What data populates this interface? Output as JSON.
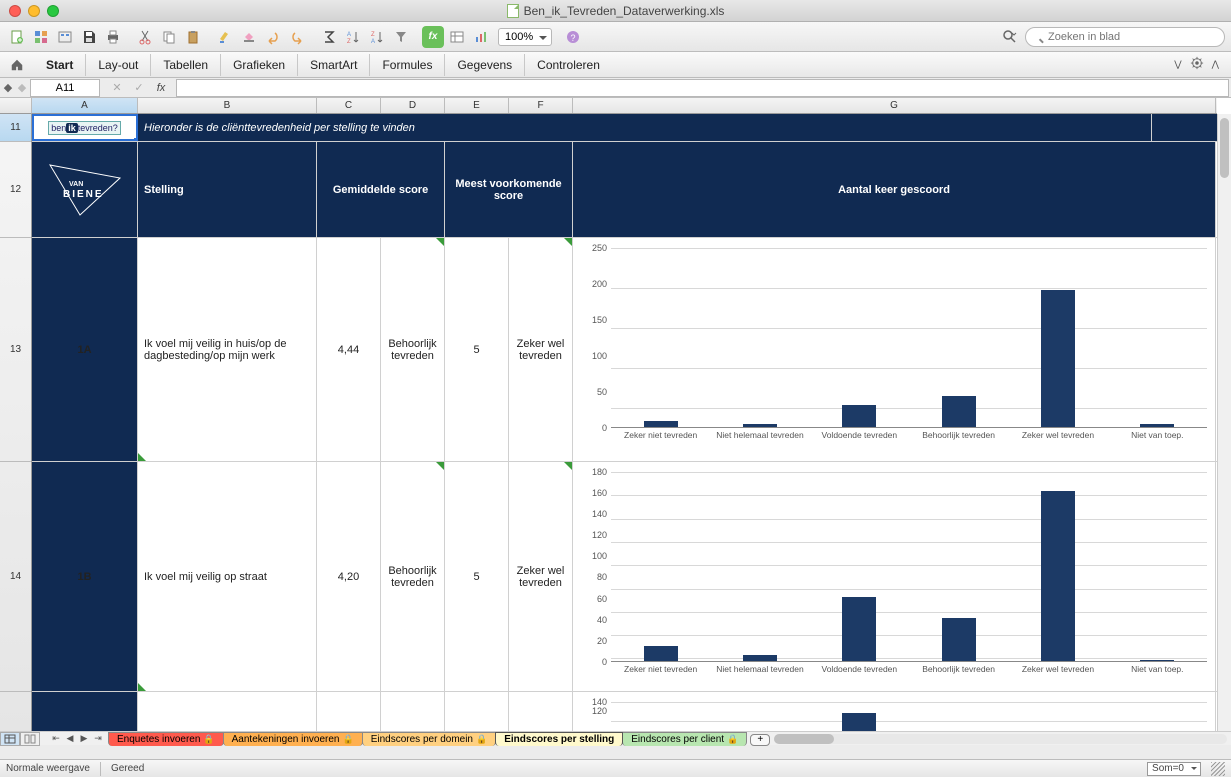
{
  "window": {
    "title": "Ben_ik_Tevreden_Dataverwerking.xls"
  },
  "toolbar": {
    "zoom": "100%",
    "search_placeholder": "Zoeken in blad"
  },
  "ribbon": {
    "tabs": [
      "Start",
      "Lay-out",
      "Tabellen",
      "Grafieken",
      "SmartArt",
      "Formules",
      "Gegevens",
      "Controleren"
    ]
  },
  "namebox": "A11",
  "columns": [
    "A",
    "B",
    "C",
    "D",
    "E",
    "F",
    "G"
  ],
  "rows": {
    "r11": {
      "num": "11",
      "banner_a": "ben",
      "banner_a2": "ik",
      "banner_a3": "tevreden?",
      "banner_text": "Hieronder is de cliënttevredenheid per stelling te vinden"
    },
    "r12": {
      "num": "12",
      "stelling": "Stelling",
      "gem": "Gemiddelde score",
      "meest": "Meest voorkomende score",
      "aantal": "Aantal keer gescoord"
    },
    "r13": {
      "num": "13",
      "code": "1A",
      "stelling": "Ik voel mij veilig in huis/op de dagbesteding/op mijn werk",
      "gem": "4,44",
      "d": "Behoorlijk tevreden",
      "e": "5",
      "f": "Zeker wel tevreden"
    },
    "r14": {
      "num": "14",
      "code": "1B",
      "stelling": "Ik voel mij veilig op straat",
      "gem": "4,20",
      "d": "Behoorlijk tevreden",
      "e": "5",
      "f": "Zeker wel tevreden"
    }
  },
  "chart_data": [
    {
      "type": "bar",
      "title": "",
      "xlabel": "",
      "ylabel": "",
      "ylim": [
        0,
        250
      ],
      "yticks": [
        0,
        50,
        100,
        150,
        200,
        250
      ],
      "categories": [
        "Zeker niet tevreden",
        "Niet helemaal tevreden",
        "Voldoende tevreden",
        "Behoorlijk tevreden",
        "Zeker wel tevreden",
        "Niet van toepassing"
      ],
      "values": [
        10,
        5,
        32,
        45,
        192,
        5
      ]
    },
    {
      "type": "bar",
      "title": "",
      "xlabel": "",
      "ylabel": "",
      "ylim": [
        0,
        180
      ],
      "yticks": [
        0,
        20,
        40,
        60,
        80,
        100,
        120,
        140,
        160,
        180
      ],
      "categories": [
        "Zeker niet tevreden",
        "Niet helemaal tevreden",
        "Voldoende tevreden",
        "Behoorlijk tevreden",
        "Zeker wel tevreden",
        "Niet van toepassing"
      ],
      "values": [
        15,
        7,
        62,
        42,
        162,
        2
      ]
    },
    {
      "type": "bar",
      "title": "",
      "ylim": [
        0,
        140
      ],
      "yticks": [
        120,
        140
      ],
      "categories": [],
      "values": []
    }
  ],
  "xcat_short": [
    "Zeker niet tevreden",
    "Niet helemaal tevreden",
    "Voldoende tevreden",
    "Behoorlijk tevreden",
    "Zeker wel tevreden",
    "Niet van toep."
  ],
  "sheets": {
    "s1": "Enquetes invoeren",
    "s2": "Aantekeningen invoeren",
    "s3": "Eindscores per domein",
    "s4": "Eindscores per stelling",
    "s5": "Eindscores per client"
  },
  "status": {
    "view": "Normale weergave",
    "ready": "Gereed",
    "sum_label": "Som=0"
  }
}
